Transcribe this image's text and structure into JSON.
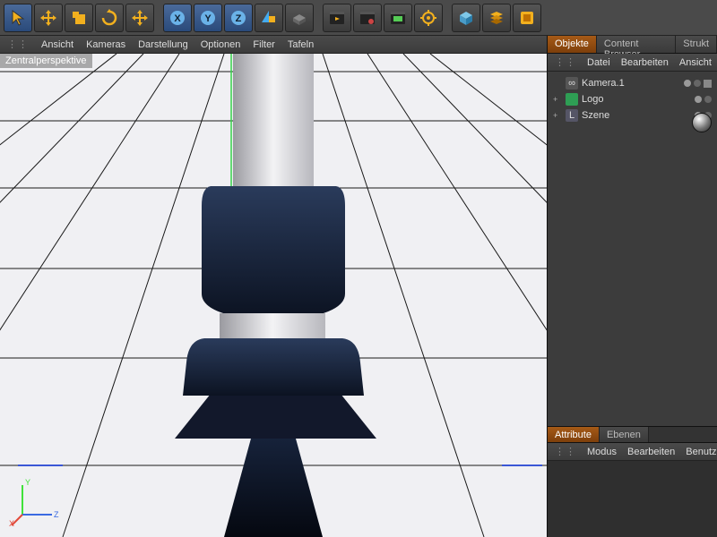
{
  "toolbar_icons": [
    "select",
    "move",
    "scale",
    "rotate",
    "lastaxis",
    "x",
    "y",
    "z",
    "transform",
    "coord",
    "clapper",
    "clapper2",
    "clapper3",
    "gear",
    "cube",
    "layers",
    "paint"
  ],
  "viewport_menu": [
    "Ansicht",
    "Kameras",
    "Darstellung",
    "Optionen",
    "Filter",
    "Tafeln"
  ],
  "perspective_label": "Zentralperspektive",
  "tabs_right": {
    "objects": "Objekte",
    "content": "Content Browser",
    "struct": "Strukt"
  },
  "obj_menu": [
    "Datei",
    "Bearbeiten",
    "Ansicht"
  ],
  "tree": [
    {
      "expander": "",
      "icon": "camera",
      "label": "Kamera.1",
      "dots": true,
      "square": true
    },
    {
      "expander": "+",
      "icon": "cube-green",
      "label": "Logo",
      "dots": true,
      "square": false
    },
    {
      "expander": "+",
      "icon": "stage",
      "label": "Szene",
      "dots": true,
      "square": false
    }
  ],
  "attr_tabs": {
    "attr": "Attribute",
    "layers": "Ebenen"
  },
  "attr_menu": [
    "Modus",
    "Bearbeiten",
    "Benutzer"
  ],
  "axes": {
    "x": "X",
    "y": "Y",
    "z": "Z"
  }
}
